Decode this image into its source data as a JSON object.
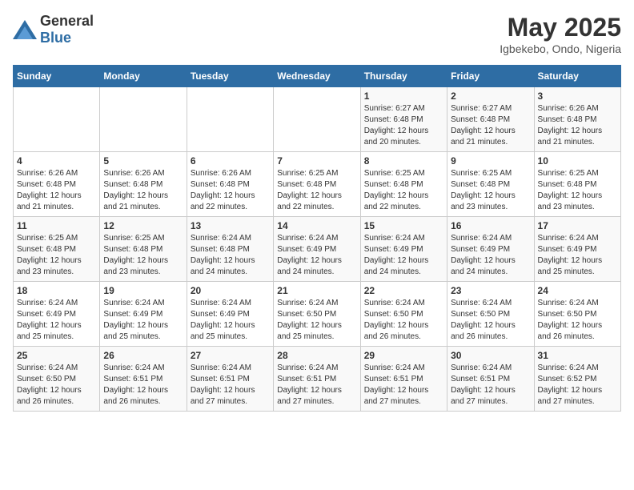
{
  "header": {
    "logo_general": "General",
    "logo_blue": "Blue",
    "title": "May 2025",
    "subtitle": "Igbekebo, Ondo, Nigeria"
  },
  "calendar": {
    "days_of_week": [
      "Sunday",
      "Monday",
      "Tuesday",
      "Wednesday",
      "Thursday",
      "Friday",
      "Saturday"
    ],
    "weeks": [
      [
        {
          "day": "",
          "sunrise": "",
          "sunset": "",
          "daylight": ""
        },
        {
          "day": "",
          "sunrise": "",
          "sunset": "",
          "daylight": ""
        },
        {
          "day": "",
          "sunrise": "",
          "sunset": "",
          "daylight": ""
        },
        {
          "day": "",
          "sunrise": "",
          "sunset": "",
          "daylight": ""
        },
        {
          "day": "1",
          "sunrise": "Sunrise: 6:27 AM",
          "sunset": "Sunset: 6:48 PM",
          "daylight": "Daylight: 12 hours and 20 minutes."
        },
        {
          "day": "2",
          "sunrise": "Sunrise: 6:27 AM",
          "sunset": "Sunset: 6:48 PM",
          "daylight": "Daylight: 12 hours and 21 minutes."
        },
        {
          "day": "3",
          "sunrise": "Sunrise: 6:26 AM",
          "sunset": "Sunset: 6:48 PM",
          "daylight": "Daylight: 12 hours and 21 minutes."
        }
      ],
      [
        {
          "day": "4",
          "sunrise": "Sunrise: 6:26 AM",
          "sunset": "Sunset: 6:48 PM",
          "daylight": "Daylight: 12 hours and 21 minutes."
        },
        {
          "day": "5",
          "sunrise": "Sunrise: 6:26 AM",
          "sunset": "Sunset: 6:48 PM",
          "daylight": "Daylight: 12 hours and 21 minutes."
        },
        {
          "day": "6",
          "sunrise": "Sunrise: 6:26 AM",
          "sunset": "Sunset: 6:48 PM",
          "daylight": "Daylight: 12 hours and 22 minutes."
        },
        {
          "day": "7",
          "sunrise": "Sunrise: 6:25 AM",
          "sunset": "Sunset: 6:48 PM",
          "daylight": "Daylight: 12 hours and 22 minutes."
        },
        {
          "day": "8",
          "sunrise": "Sunrise: 6:25 AM",
          "sunset": "Sunset: 6:48 PM",
          "daylight": "Daylight: 12 hours and 22 minutes."
        },
        {
          "day": "9",
          "sunrise": "Sunrise: 6:25 AM",
          "sunset": "Sunset: 6:48 PM",
          "daylight": "Daylight: 12 hours and 23 minutes."
        },
        {
          "day": "10",
          "sunrise": "Sunrise: 6:25 AM",
          "sunset": "Sunset: 6:48 PM",
          "daylight": "Daylight: 12 hours and 23 minutes."
        }
      ],
      [
        {
          "day": "11",
          "sunrise": "Sunrise: 6:25 AM",
          "sunset": "Sunset: 6:48 PM",
          "daylight": "Daylight: 12 hours and 23 minutes."
        },
        {
          "day": "12",
          "sunrise": "Sunrise: 6:25 AM",
          "sunset": "Sunset: 6:48 PM",
          "daylight": "Daylight: 12 hours and 23 minutes."
        },
        {
          "day": "13",
          "sunrise": "Sunrise: 6:24 AM",
          "sunset": "Sunset: 6:48 PM",
          "daylight": "Daylight: 12 hours and 24 minutes."
        },
        {
          "day": "14",
          "sunrise": "Sunrise: 6:24 AM",
          "sunset": "Sunset: 6:49 PM",
          "daylight": "Daylight: 12 hours and 24 minutes."
        },
        {
          "day": "15",
          "sunrise": "Sunrise: 6:24 AM",
          "sunset": "Sunset: 6:49 PM",
          "daylight": "Daylight: 12 hours and 24 minutes."
        },
        {
          "day": "16",
          "sunrise": "Sunrise: 6:24 AM",
          "sunset": "Sunset: 6:49 PM",
          "daylight": "Daylight: 12 hours and 24 minutes."
        },
        {
          "day": "17",
          "sunrise": "Sunrise: 6:24 AM",
          "sunset": "Sunset: 6:49 PM",
          "daylight": "Daylight: 12 hours and 25 minutes."
        }
      ],
      [
        {
          "day": "18",
          "sunrise": "Sunrise: 6:24 AM",
          "sunset": "Sunset: 6:49 PM",
          "daylight": "Daylight: 12 hours and 25 minutes."
        },
        {
          "day": "19",
          "sunrise": "Sunrise: 6:24 AM",
          "sunset": "Sunset: 6:49 PM",
          "daylight": "Daylight: 12 hours and 25 minutes."
        },
        {
          "day": "20",
          "sunrise": "Sunrise: 6:24 AM",
          "sunset": "Sunset: 6:49 PM",
          "daylight": "Daylight: 12 hours and 25 minutes."
        },
        {
          "day": "21",
          "sunrise": "Sunrise: 6:24 AM",
          "sunset": "Sunset: 6:50 PM",
          "daylight": "Daylight: 12 hours and 25 minutes."
        },
        {
          "day": "22",
          "sunrise": "Sunrise: 6:24 AM",
          "sunset": "Sunset: 6:50 PM",
          "daylight": "Daylight: 12 hours and 26 minutes."
        },
        {
          "day": "23",
          "sunrise": "Sunrise: 6:24 AM",
          "sunset": "Sunset: 6:50 PM",
          "daylight": "Daylight: 12 hours and 26 minutes."
        },
        {
          "day": "24",
          "sunrise": "Sunrise: 6:24 AM",
          "sunset": "Sunset: 6:50 PM",
          "daylight": "Daylight: 12 hours and 26 minutes."
        }
      ],
      [
        {
          "day": "25",
          "sunrise": "Sunrise: 6:24 AM",
          "sunset": "Sunset: 6:50 PM",
          "daylight": "Daylight: 12 hours and 26 minutes."
        },
        {
          "day": "26",
          "sunrise": "Sunrise: 6:24 AM",
          "sunset": "Sunset: 6:51 PM",
          "daylight": "Daylight: 12 hours and 26 minutes."
        },
        {
          "day": "27",
          "sunrise": "Sunrise: 6:24 AM",
          "sunset": "Sunset: 6:51 PM",
          "daylight": "Daylight: 12 hours and 27 minutes."
        },
        {
          "day": "28",
          "sunrise": "Sunrise: 6:24 AM",
          "sunset": "Sunset: 6:51 PM",
          "daylight": "Daylight: 12 hours and 27 minutes."
        },
        {
          "day": "29",
          "sunrise": "Sunrise: 6:24 AM",
          "sunset": "Sunset: 6:51 PM",
          "daylight": "Daylight: 12 hours and 27 minutes."
        },
        {
          "day": "30",
          "sunrise": "Sunrise: 6:24 AM",
          "sunset": "Sunset: 6:51 PM",
          "daylight": "Daylight: 12 hours and 27 minutes."
        },
        {
          "day": "31",
          "sunrise": "Sunrise: 6:24 AM",
          "sunset": "Sunset: 6:52 PM",
          "daylight": "Daylight: 12 hours and 27 minutes."
        }
      ]
    ]
  }
}
